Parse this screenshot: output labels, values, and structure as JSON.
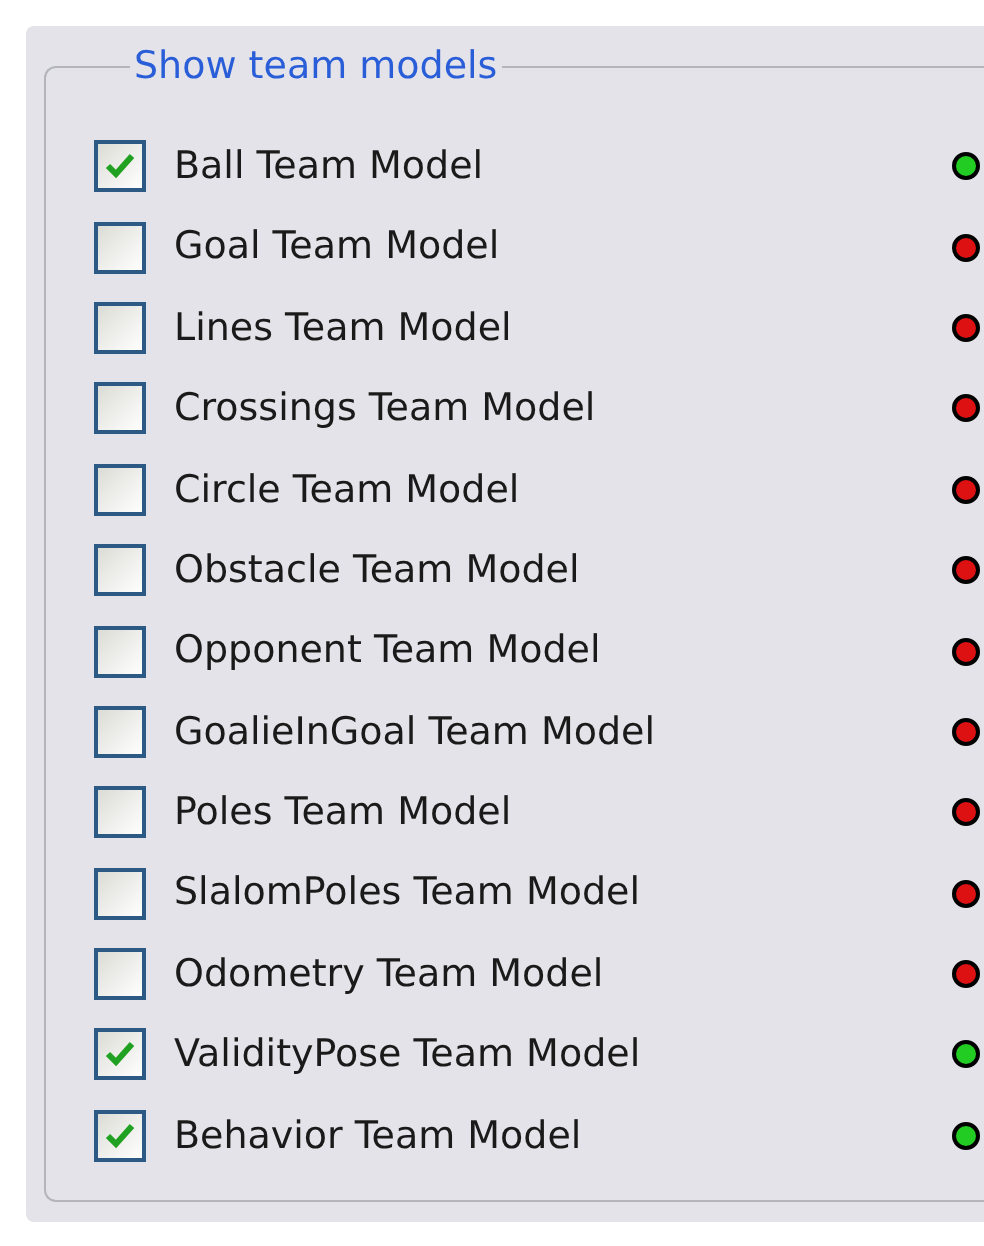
{
  "group": {
    "title": "Show team models",
    "items": [
      {
        "label": "Ball Team Model",
        "checked": true,
        "color": "#22cc22"
      },
      {
        "label": "Goal Team Model",
        "checked": false,
        "color": "#dd1111"
      },
      {
        "label": "Lines Team Model",
        "checked": false,
        "color": "#dd1111"
      },
      {
        "label": "Crossings Team Model",
        "checked": false,
        "color": "#dd1111"
      },
      {
        "label": "Circle Team Model",
        "checked": false,
        "color": "#dd1111"
      },
      {
        "label": "Obstacle Team Model",
        "checked": false,
        "color": "#dd1111"
      },
      {
        "label": "Opponent Team Model",
        "checked": false,
        "color": "#dd1111"
      },
      {
        "label": "GoalieInGoal Team Model",
        "checked": false,
        "color": "#dd1111"
      },
      {
        "label": "Poles Team Model",
        "checked": false,
        "color": "#dd1111"
      },
      {
        "label": "SlalomPoles Team Model",
        "checked": false,
        "color": "#dd1111"
      },
      {
        "label": "Odometry Team Model",
        "checked": false,
        "color": "#dd1111"
      },
      {
        "label": "ValidityPose Team Model",
        "checked": true,
        "color": "#22cc22"
      },
      {
        "label": "Behavior Team Model",
        "checked": true,
        "color": "#22cc22"
      }
    ]
  }
}
